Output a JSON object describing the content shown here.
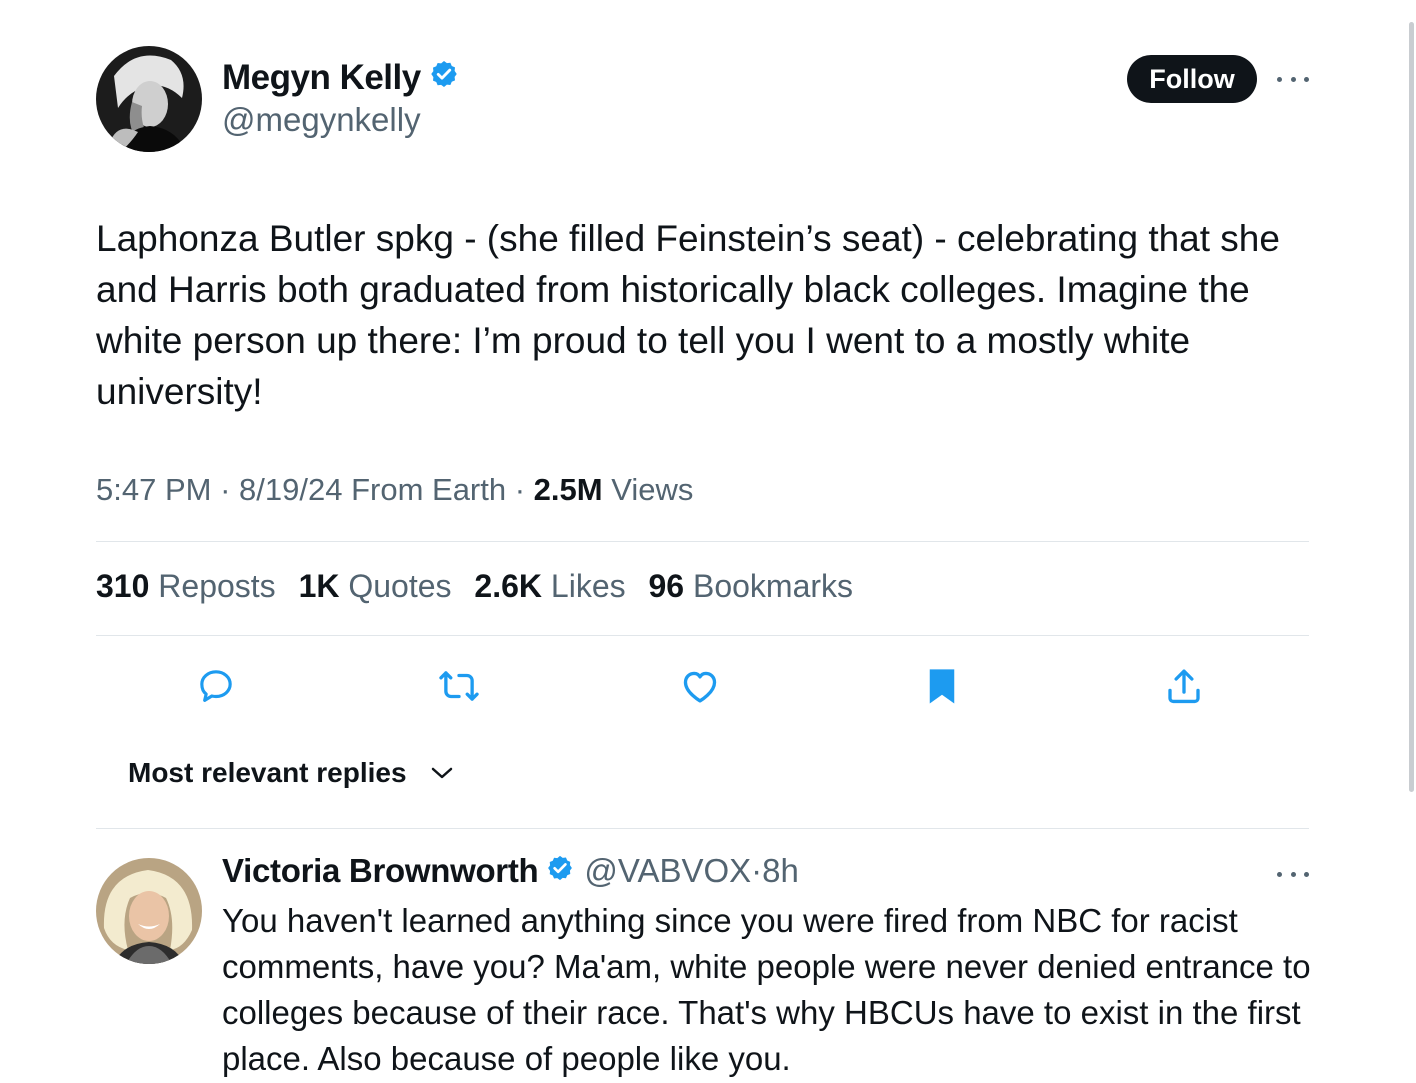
{
  "tweet": {
    "author": {
      "name": "Megyn Kelly",
      "handle": "@megynkelly"
    },
    "follow_label": "Follow",
    "text": "Laphonza Butler spkg - (she filled Feinstein’s seat) - celebrating that she and Harris both graduated from historically black colleges. Imagine the white person up there: I’m proud to tell you I went to a mostly white university!",
    "time": "5:47 PM",
    "date": "8/19/24",
    "source": "From Earth",
    "views_count": "2.5M",
    "views_label": "Views",
    "stats": {
      "reposts": {
        "count": "310",
        "label": "Reposts"
      },
      "quotes": {
        "count": "1K",
        "label": "Quotes"
      },
      "likes": {
        "count": "2.6K",
        "label": "Likes"
      },
      "bookmarks": {
        "count": "96",
        "label": "Bookmarks"
      }
    }
  },
  "actions": [
    {
      "icon": "reply-icon"
    },
    {
      "icon": "repost-icon"
    },
    {
      "icon": "like-icon"
    },
    {
      "icon": "bookmark-icon",
      "active": true,
      "color": "#1d9bf0"
    },
    {
      "icon": "share-icon"
    }
  ],
  "replies_sort": {
    "label": "Most relevant replies"
  },
  "reply": {
    "name": "Victoria Brownworth",
    "handle": "@VABVOX",
    "age": "8h",
    "text": "You haven't learned anything since you were fired from NBC for racist comments, have you? Ma'am, white people were never denied entrance to colleges because of their race. That's why HBCUs have to exist in the first place. Also because of people like you."
  },
  "colors": {
    "accent": "#1d9bf0",
    "text": "#0f1419",
    "secondary": "#536471",
    "border": "#e1e6ea"
  }
}
